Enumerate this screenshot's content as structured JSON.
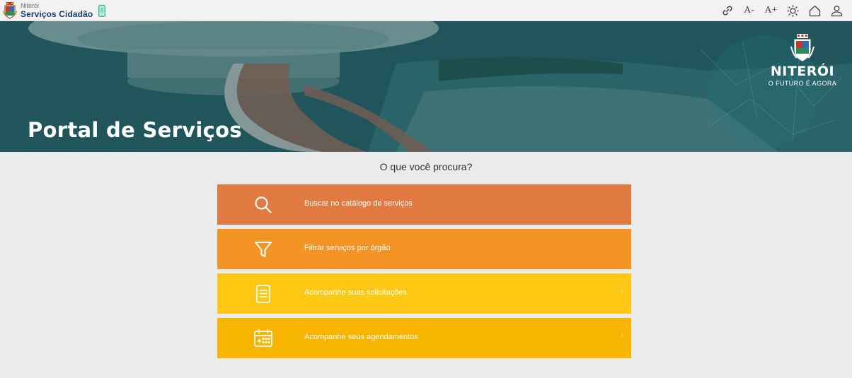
{
  "header": {
    "city": "Niterói",
    "app_name": "Serviços Cidadão",
    "tools": [
      {
        "icon": "link-icon",
        "label": ""
      },
      {
        "icon": "font-decrease-icon",
        "label": "A-"
      },
      {
        "icon": "font-increase-icon",
        "label": "A+"
      },
      {
        "icon": "contrast-sun-icon",
        "label": ""
      },
      {
        "icon": "home-icon",
        "label": ""
      },
      {
        "icon": "user-icon",
        "label": ""
      }
    ]
  },
  "hero": {
    "title": "Portal de Serviços",
    "logo_name": "NITERÓI",
    "logo_tagline": "O FUTURO É AGORA"
  },
  "main": {
    "question": "O que você procura?",
    "options": [
      {
        "label": "Buscar no catálogo de serviços",
        "icon": "search-icon",
        "color": "#e07a40",
        "arrow": ""
      },
      {
        "label": "Filtrar serviços por órgão",
        "icon": "filter-icon",
        "color": "#f39425",
        "arrow": ""
      },
      {
        "label": "Acompanhe suas solicitações",
        "icon": "document-icon",
        "color": "#fcc814",
        "arrow": "›"
      },
      {
        "label": "Acompanhe seus agendamentos",
        "icon": "calendar-icon",
        "color": "#f7b500",
        "arrow": "›"
      }
    ]
  },
  "colors": {
    "brand_blue": "#1f3f6e",
    "phone_green": "#2bbf8a",
    "hero_teal": "#2a6165"
  }
}
